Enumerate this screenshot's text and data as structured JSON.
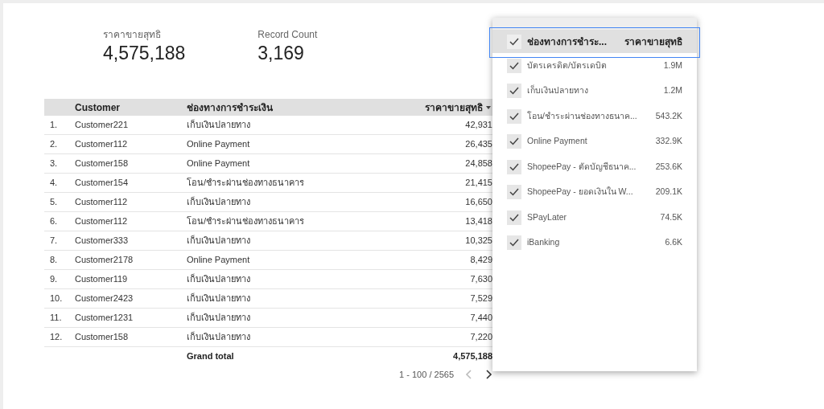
{
  "scorecards": [
    {
      "label": "ราคาขายสุทธิ",
      "value": "4,575,188"
    },
    {
      "label": "Record Count",
      "value": "3,169"
    }
  ],
  "table": {
    "columns": [
      "Customer",
      "ช่องทางการชำระเงิน",
      "ราคาขายสุทธิ"
    ],
    "rows": [
      {
        "index": "1.",
        "customer": "Customer221",
        "channel": "เก็บเงินปลายทาง",
        "amount": "42,931"
      },
      {
        "index": "2.",
        "customer": "Customer112",
        "channel": "Online Payment",
        "amount": "26,435"
      },
      {
        "index": "3.",
        "customer": "Customer158",
        "channel": "Online Payment",
        "amount": "24,858"
      },
      {
        "index": "4.",
        "customer": "Customer154",
        "channel": "โอน/ชำระผ่านช่องทางธนาคาร",
        "amount": "21,415"
      },
      {
        "index": "5.",
        "customer": "Customer112",
        "channel": "เก็บเงินปลายทาง",
        "amount": "16,650"
      },
      {
        "index": "6.",
        "customer": "Customer112",
        "channel": "โอน/ชำระผ่านช่องทางธนาคาร",
        "amount": "13,418"
      },
      {
        "index": "7.",
        "customer": "Customer333",
        "channel": "เก็บเงินปลายทาง",
        "amount": "10,325"
      },
      {
        "index": "8.",
        "customer": "Customer2178",
        "channel": "Online Payment",
        "amount": "8,429"
      },
      {
        "index": "9.",
        "customer": "Customer119",
        "channel": "เก็บเงินปลายทาง",
        "amount": "7,630"
      },
      {
        "index": "10.",
        "customer": "Customer2423",
        "channel": "เก็บเงินปลายทาง",
        "amount": "7,529"
      },
      {
        "index": "11.",
        "customer": "Customer1231",
        "channel": "เก็บเงินปลายทาง",
        "amount": "7,440"
      },
      {
        "index": "12.",
        "customer": "Customer158",
        "channel": "เก็บเงินปลายทาง",
        "amount": "7,220"
      }
    ],
    "grand_total": {
      "label": "Grand total",
      "value": "4,575,188"
    },
    "pagination": "1 - 100 / 2565"
  },
  "filter": {
    "header": {
      "checked": true,
      "columns": [
        "ช่องทางการชำระ...",
        "ราคาขายสุทธิ"
      ]
    },
    "items": [
      {
        "label": "บัตรเครดิต/บัตรเดบิต",
        "value": "1.9M",
        "checked": true
      },
      {
        "label": "เก็บเงินปลายทาง",
        "value": "1.2M",
        "checked": true
      },
      {
        "label": "โอน/ชำระผ่านช่องทางธนาค...",
        "value": "543.2K",
        "checked": true
      },
      {
        "label": "Online Payment",
        "value": "332.9K",
        "checked": true
      },
      {
        "label": "ShopeePay - ตัดบัญชีธนาค...",
        "value": "253.6K",
        "checked": true
      },
      {
        "label": "ShopeePay - ยอดเงินใน W...",
        "value": "209.1K",
        "checked": true
      },
      {
        "label": "SPayLater",
        "value": "74.5K",
        "checked": true
      },
      {
        "label": "iBanking",
        "value": "6.6K",
        "checked": true
      }
    ]
  }
}
